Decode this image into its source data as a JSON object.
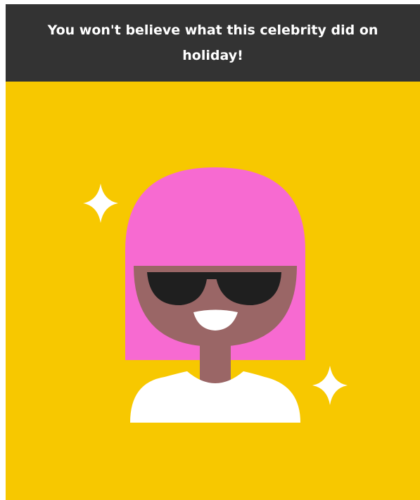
{
  "article": {
    "headline": "You won't believe what this celebrity did on holiday!"
  },
  "colors": {
    "headline_bg": "#333333",
    "headline_text": "#ffffff",
    "illustration_bg": "#f7c800",
    "hair": "#f76ad1",
    "skin": "#9a6666",
    "sunglasses": "#1f1f1f",
    "shirt": "#ffffff",
    "sparkle": "#ffffff"
  },
  "icons": [
    "sparkle-icon",
    "celebrity-avatar"
  ]
}
